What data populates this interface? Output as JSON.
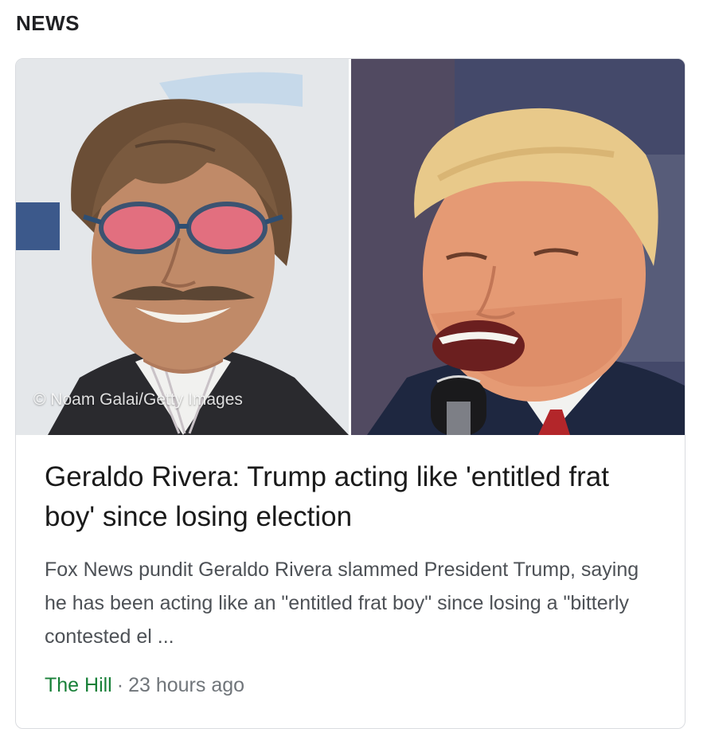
{
  "section": {
    "title": "NEWS"
  },
  "article": {
    "image_credit": "© Noam Galai/Getty Images",
    "headline": "Geraldo Rivera: Trump acting like 'entitled frat boy' since losing election",
    "snippet": "Fox News pundit Geraldo Rivera slammed President Trump, saying he has been acting like an \"entitled frat boy\" since losing a \"bitterly contested el ...",
    "source": "The Hill",
    "separator": "·",
    "time_ago": "23 hours ago"
  },
  "colors": {
    "source": "#188038",
    "meta": "#70757a",
    "headline": "#1a1a1a",
    "snippet": "#4d5156"
  }
}
